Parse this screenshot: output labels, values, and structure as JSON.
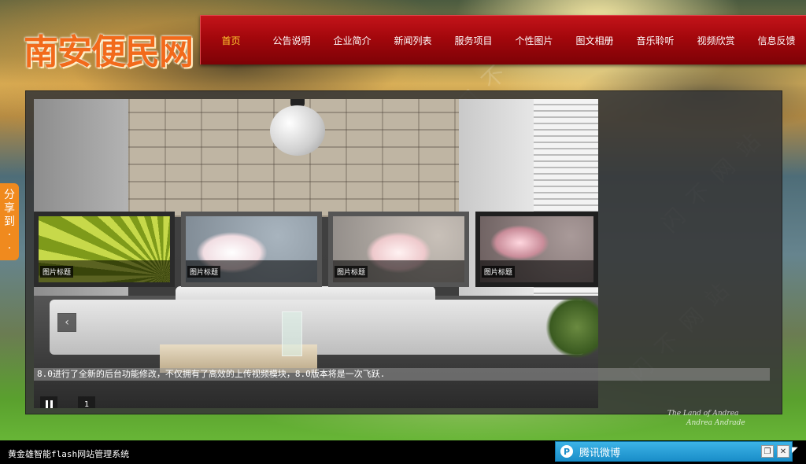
{
  "site": {
    "logo_text": "南安便民网"
  },
  "nav": {
    "items": [
      "首页",
      "公告说明",
      "企业简介",
      "新闻列表",
      "服务项目",
      "个性图片",
      "图文相册",
      "音乐聆听",
      "视频欣赏",
      "信息反馈"
    ],
    "active_index": 0,
    "active_color": "#ffcc2f"
  },
  "slider": {
    "thumbnails": [
      {
        "caption": "图片标题"
      },
      {
        "caption": "图片标题"
      },
      {
        "caption": "图片标题"
      },
      {
        "caption": "图片标题"
      }
    ],
    "prev_icon": "chevron-left-icon",
    "caption": "8.0进行了全新的后台功能修改，不仅拥有了高效的上传视频模块，8.0版本将是一次飞跃.",
    "pause_icon": "pause-icon",
    "page_number": "1"
  },
  "share": {
    "label_chars": [
      "分",
      "享",
      "到",
      "·",
      "·"
    ]
  },
  "background": {
    "signature_line1": "The Land of Andrea",
    "signature_line2": "Andrea Andrade"
  },
  "footer": {
    "text": "黄金雄智能flash网站管理系统"
  },
  "weibo": {
    "title": "腾讯微博",
    "icon": "weibo-logo-icon",
    "restore_icon": "restore-icon",
    "close_icon": "close-icon"
  }
}
